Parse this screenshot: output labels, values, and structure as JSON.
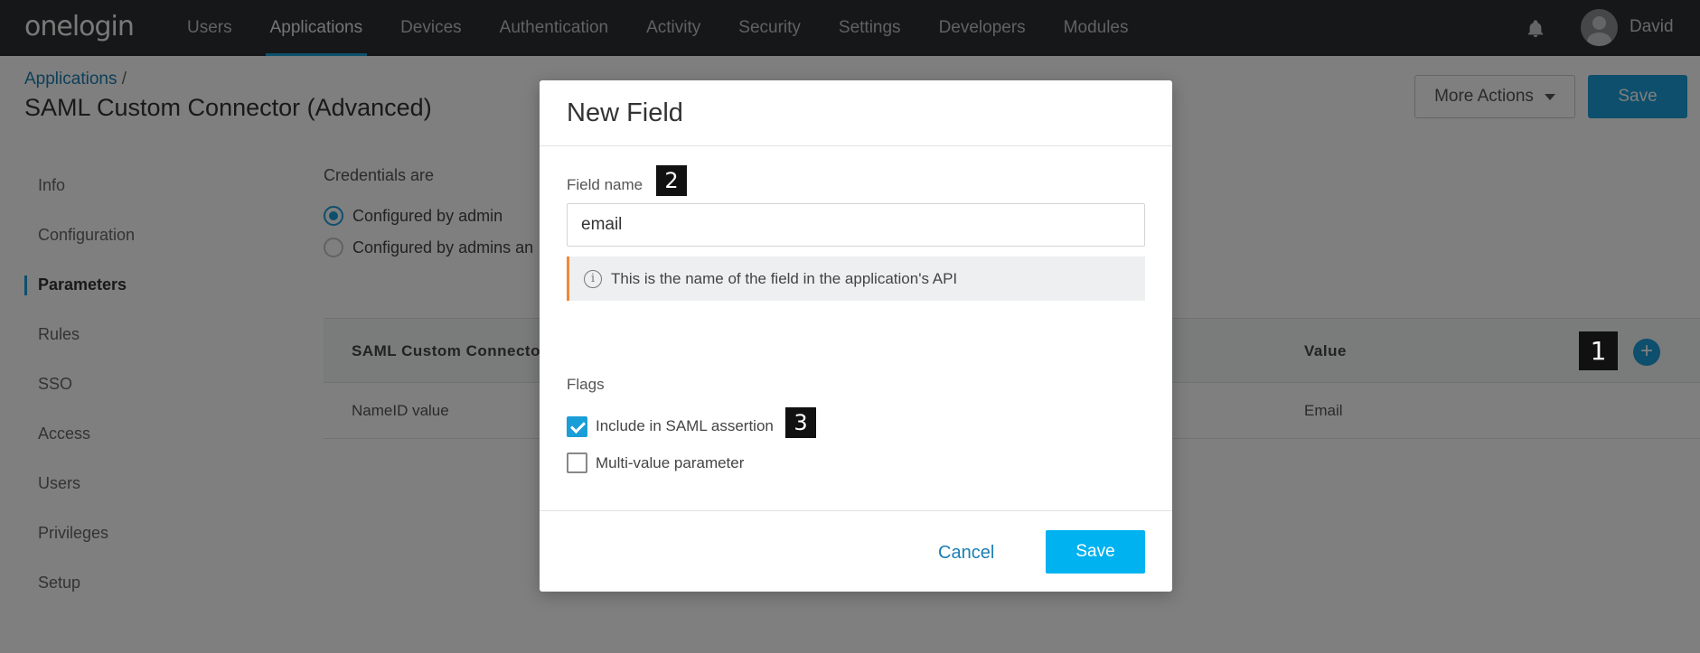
{
  "app": {
    "logo": "onelogin",
    "user_name": "David"
  },
  "nav": {
    "items": [
      {
        "label": "Users"
      },
      {
        "label": "Applications"
      },
      {
        "label": "Devices"
      },
      {
        "label": "Authentication"
      },
      {
        "label": "Activity"
      },
      {
        "label": "Security"
      },
      {
        "label": "Settings"
      },
      {
        "label": "Developers"
      },
      {
        "label": "Modules"
      }
    ],
    "active": "Applications"
  },
  "breadcrumb": {
    "link": "Applications",
    "separator": "/"
  },
  "page": {
    "title": "SAML Custom Connector (Advanced)",
    "more_actions_label": "More Actions",
    "save_label": "Save"
  },
  "sidebar": {
    "items": [
      {
        "label": "Info"
      },
      {
        "label": "Configuration"
      },
      {
        "label": "Parameters"
      },
      {
        "label": "Rules"
      },
      {
        "label": "SSO"
      },
      {
        "label": "Access"
      },
      {
        "label": "Users"
      },
      {
        "label": "Privileges"
      },
      {
        "label": "Setup"
      }
    ],
    "active": "Parameters"
  },
  "credentials": {
    "label": "Credentials are",
    "options": [
      {
        "label": "Configured by admin",
        "selected": true
      },
      {
        "label": "Configured by admins an",
        "selected": false
      }
    ]
  },
  "params_table": {
    "headers": [
      "SAML Custom Connector",
      "Value"
    ],
    "rows": [
      {
        "name": "NameID value",
        "value": "Email"
      }
    ]
  },
  "modal": {
    "title": "New Field",
    "field_label": "Field name",
    "field_value": "email",
    "hint": "This is the name of the field in the application's API",
    "flags_label": "Flags",
    "flags": [
      {
        "label": "Include in SAML assertion",
        "checked": true
      },
      {
        "label": "Multi-value parameter",
        "checked": false
      }
    ],
    "cancel_label": "Cancel",
    "save_label": "Save"
  },
  "annotations": [
    "1",
    "2",
    "3"
  ],
  "colors": {
    "accent": "#1a9ed8",
    "modal_save": "#00b3f0",
    "topbar": "#2d2f31",
    "hint_border": "#f0893a"
  }
}
